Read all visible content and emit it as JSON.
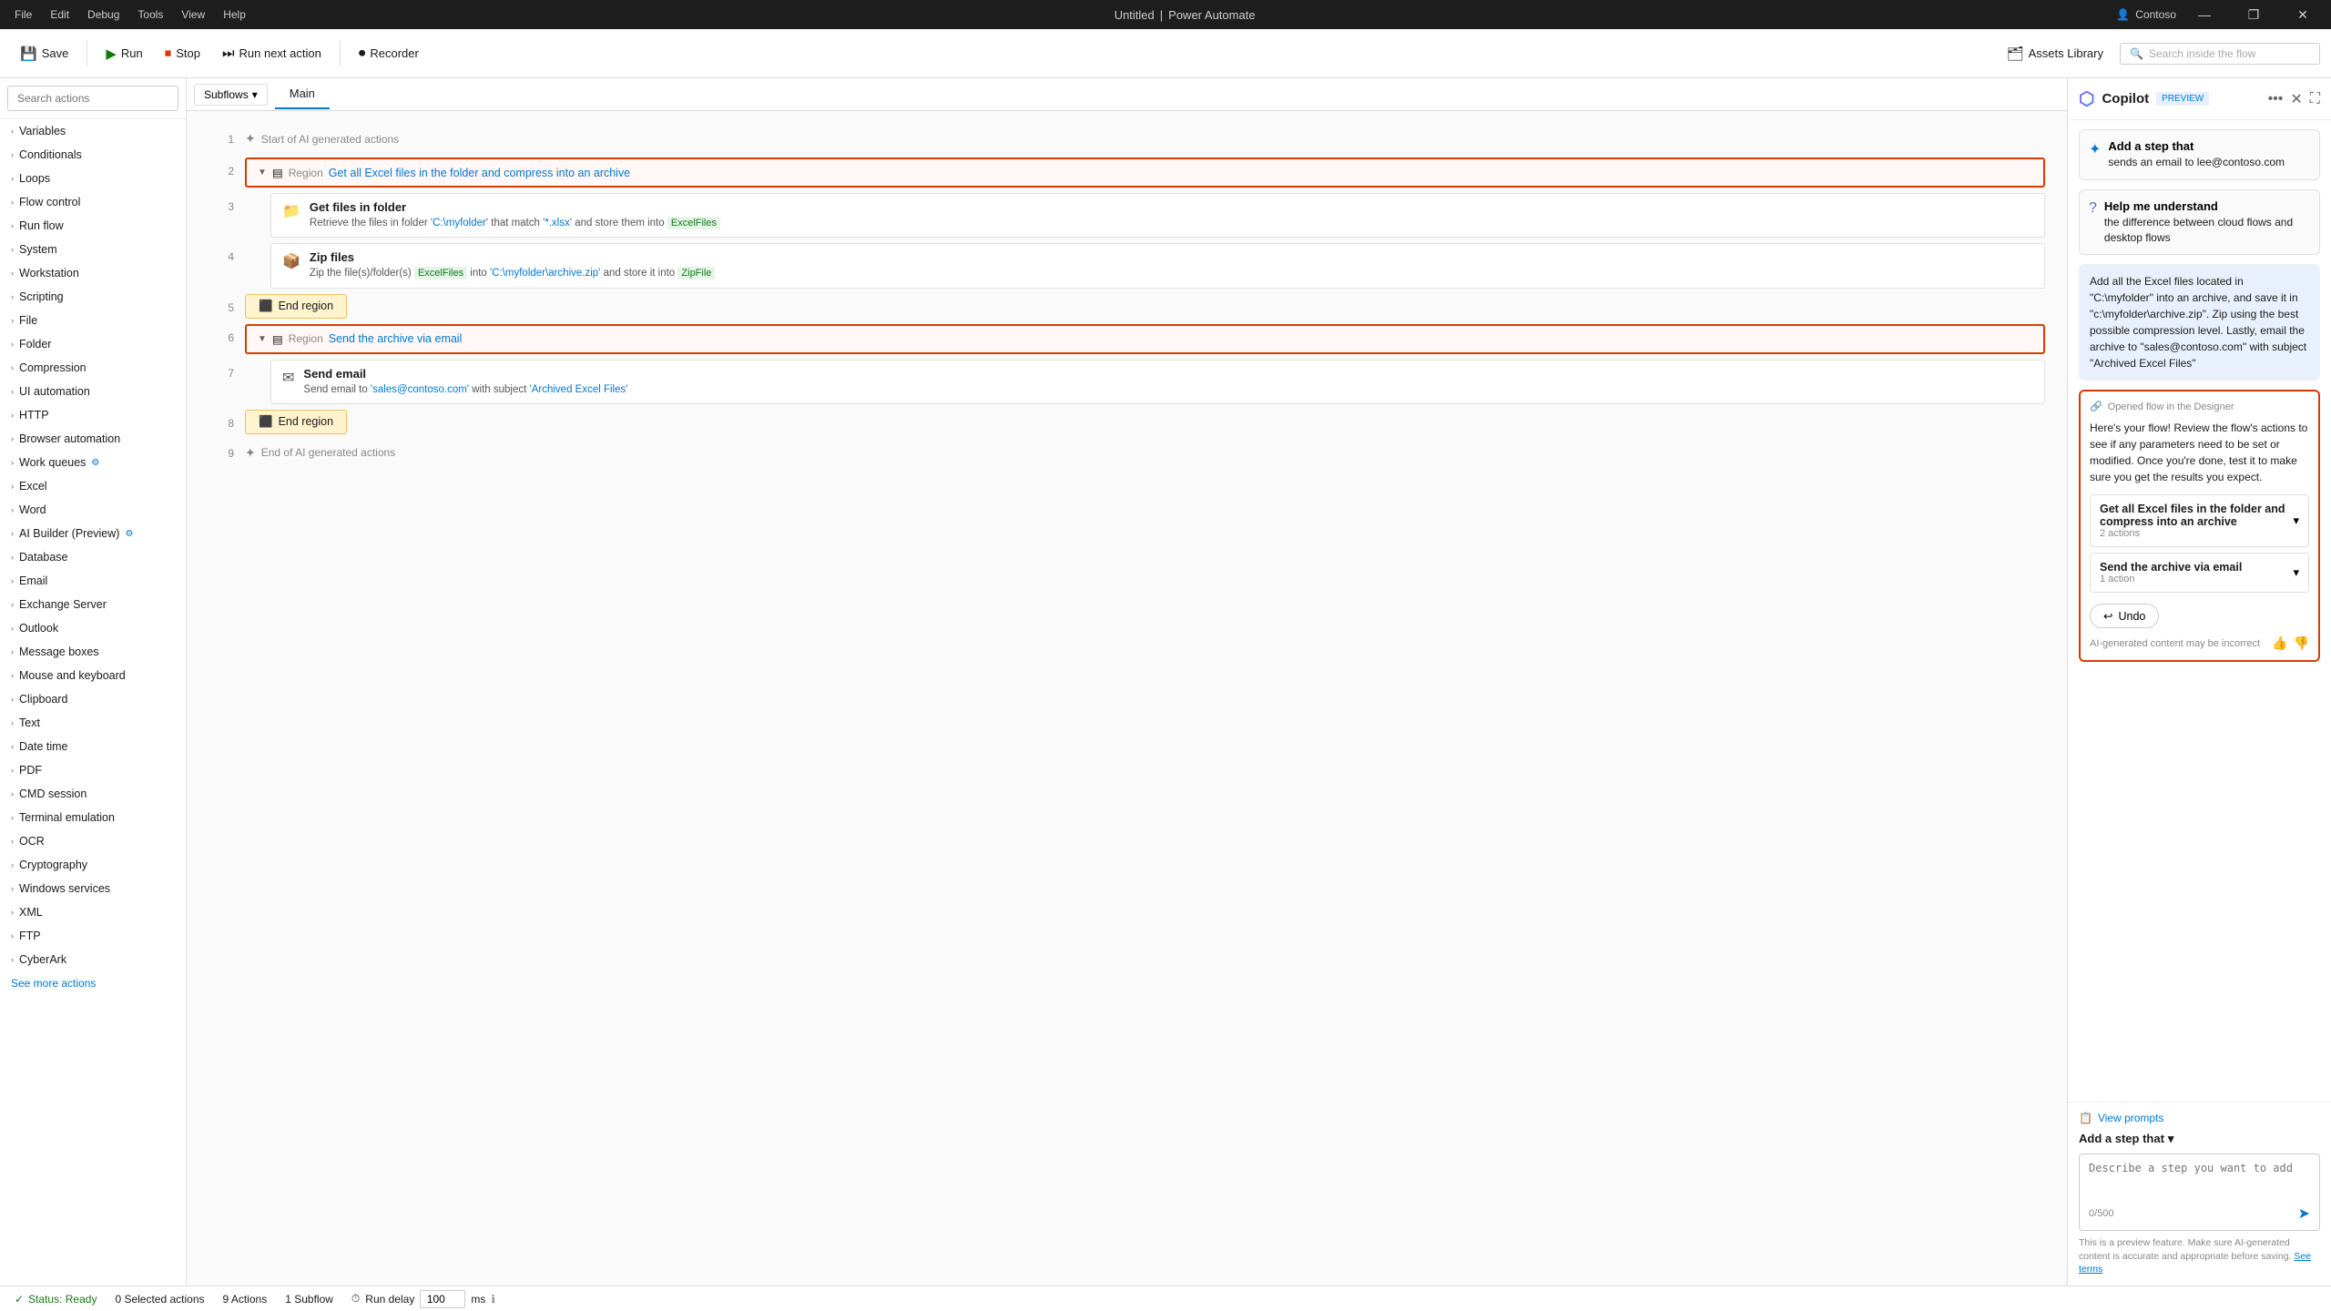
{
  "titleBar": {
    "appName": "Power Automate",
    "docName": "Untitled",
    "separator": "|",
    "menu": [
      "File",
      "Edit",
      "Debug",
      "Tools",
      "View",
      "Help"
    ],
    "account": "Contoso",
    "winButtons": [
      "—",
      "❐",
      "✕"
    ]
  },
  "toolbar": {
    "save": "Save",
    "run": "Run",
    "stop": "Stop",
    "runNextAction": "Run next action",
    "recorder": "Recorder",
    "assetsLibrary": "Assets Library",
    "searchInsidePlaceholder": "Search inside the flow"
  },
  "sidebar": {
    "searchPlaceholder": "Search actions",
    "items": [
      {
        "label": "Variables"
      },
      {
        "label": "Conditionals"
      },
      {
        "label": "Loops"
      },
      {
        "label": "Flow control"
      },
      {
        "label": "Run flow"
      },
      {
        "label": "System"
      },
      {
        "label": "Workstation"
      },
      {
        "label": "Scripting"
      },
      {
        "label": "File"
      },
      {
        "label": "Folder"
      },
      {
        "label": "Compression"
      },
      {
        "label": "UI automation"
      },
      {
        "label": "HTTP"
      },
      {
        "label": "Browser automation"
      },
      {
        "label": "Work queues",
        "badge": true
      },
      {
        "label": "Excel"
      },
      {
        "label": "Word"
      },
      {
        "label": "AI Builder (Preview)",
        "badge": true
      },
      {
        "label": "Database"
      },
      {
        "label": "Email"
      },
      {
        "label": "Exchange Server"
      },
      {
        "label": "Outlook"
      },
      {
        "label": "Message boxes"
      },
      {
        "label": "Mouse and keyboard"
      },
      {
        "label": "Clipboard"
      },
      {
        "label": "Text"
      },
      {
        "label": "Date time"
      },
      {
        "label": "PDF"
      },
      {
        "label": "CMD session"
      },
      {
        "label": "Terminal emulation"
      },
      {
        "label": "OCR"
      },
      {
        "label": "Cryptography"
      },
      {
        "label": "Windows services"
      },
      {
        "label": "XML"
      },
      {
        "label": "FTP"
      },
      {
        "label": "CyberArk"
      }
    ],
    "seeMore": "See more actions"
  },
  "flowTabs": {
    "subflows": "Subflows",
    "main": "Main"
  },
  "flowContent": {
    "startLabel": "Start of AI generated actions",
    "endLabel": "End of AI generated actions",
    "rows": [
      {
        "num": 1,
        "type": "start-ai"
      },
      {
        "num": 2,
        "type": "region",
        "regionLabel": "Region",
        "regionName": "Get all Excel files in the folder and compress into an archive"
      },
      {
        "num": 3,
        "type": "action",
        "title": "Get files in folder",
        "desc": "Retrieve the files in folder 'C:\\myfolder' that match '*.xlsx' and store them into",
        "highlight1": "C:\\myfolder",
        "highlight2": "*.xlsx",
        "varHighlight": "ExcelFiles"
      },
      {
        "num": 4,
        "type": "action",
        "title": "Zip files",
        "desc": "Zip the file(s)/folder(s)",
        "var1": "ExcelFiles",
        "desc2": "into 'C:\\myfolder\\archive.zip' and store it into",
        "highlight3": "C:\\myfolder\\archive.zip",
        "var2": "ZipFile"
      },
      {
        "num": 5,
        "type": "end-region"
      },
      {
        "num": 6,
        "type": "region",
        "regionLabel": "Region",
        "regionName": "Send the archive via email"
      },
      {
        "num": 7,
        "type": "action",
        "title": "Send email",
        "desc": "Send email to",
        "emailHL": "sales@contoso.com",
        "desc2": "with subject",
        "subjectHL": "Archived Excel Files"
      },
      {
        "num": 8,
        "type": "end-region"
      },
      {
        "num": 9,
        "type": "end-ai"
      }
    ]
  },
  "copilot": {
    "title": "Copilot",
    "preview": "PREVIEW",
    "suggestions": [
      {
        "icon": "✦",
        "title": "Add a step that",
        "desc": "sends an email to lee@contoso.com"
      },
      {
        "icon": "?",
        "title": "Help me understand",
        "desc": "the difference between cloud flows and desktop flows"
      }
    ],
    "message": "Add all the Excel files located in \"C:\\myfolder\" into an archive, and save it in \"c:\\myfolder\\archive.zip\". Zip using the best possible compression level. Lastly, email the archive to \"sales@contoso.com\" with subject \"Archived Excel Files\"",
    "openedFlowLabel": "Opened flow in the Designer",
    "openedFlowMsg": "Here's your flow! Review the flow's actions to see if any parameters need to be set or modified. Once you're done, test it to make sure you get the results you expect.",
    "regions": [
      {
        "name": "Get all Excel files in the folder and compress into an archive",
        "count": "2 actions"
      },
      {
        "name": "Send the archive via email",
        "count": "1 action"
      }
    ],
    "undoBtn": "Undo",
    "aiDisclaimer": "AI-generated content may be incorrect",
    "viewPrompts": "View prompts",
    "addStepLabel": "Add a step that",
    "inputPlaceholder": "Describe a step you want to add",
    "charCount": "0/500",
    "disclaimer": "This is a preview feature. Make sure AI-generated content is accurate and appropriate before saving.",
    "seeTerms": "See terms"
  },
  "statusBar": {
    "status": "Status: Ready",
    "selected": "0 Selected actions",
    "totalActions": "9 Actions",
    "subflow": "1 Subflow",
    "runDelay": "Run delay",
    "delayValue": "100",
    "delayUnit": "ms"
  }
}
